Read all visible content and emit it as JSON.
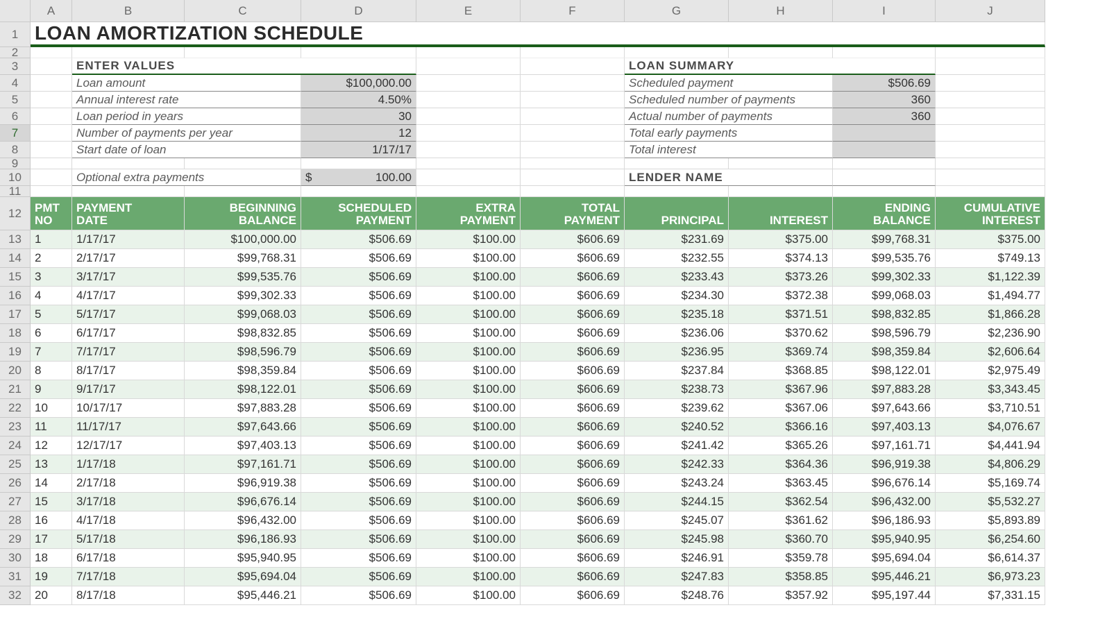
{
  "columns": [
    "A",
    "B",
    "C",
    "D",
    "E",
    "F",
    "G",
    "H",
    "I",
    "J"
  ],
  "rowNumbers": [
    "1",
    "2",
    "3",
    "4",
    "5",
    "6",
    "7",
    "8",
    "9",
    "10",
    "11",
    "12",
    "13",
    "14",
    "15",
    "16",
    "17",
    "18",
    "19",
    "20",
    "21",
    "22",
    "23",
    "24",
    "25",
    "26",
    "27",
    "28",
    "29",
    "30",
    "31",
    "32"
  ],
  "selectedRow": "7",
  "title": "LOAN AMORTIZATION SCHEDULE",
  "enterValues": {
    "heading": "ENTER VALUES",
    "rows": [
      {
        "label": "Loan amount",
        "value": "$100,000.00"
      },
      {
        "label": "Annual interest rate",
        "value": "4.50%"
      },
      {
        "label": "Loan period in years",
        "value": "30"
      },
      {
        "label": "Number of payments per year",
        "value": "12"
      },
      {
        "label": "Start date of loan",
        "value": "1/17/17"
      }
    ],
    "extra": {
      "label": "Optional extra payments",
      "prefix": "$",
      "value": "100.00"
    }
  },
  "loanSummary": {
    "heading": "LOAN SUMMARY",
    "rows": [
      {
        "label": "Scheduled payment",
        "value": "$506.69"
      },
      {
        "label": "Scheduled number of payments",
        "value": "360"
      },
      {
        "label": "Actual number of payments",
        "value": "360"
      },
      {
        "label": "Total early payments",
        "value": ""
      },
      {
        "label": "Total interest",
        "value": ""
      }
    ],
    "lender": {
      "label": "LENDER NAME",
      "value": ""
    }
  },
  "tableHeaders": {
    "pmtNo": [
      "PMT",
      "NO"
    ],
    "paymentDate": [
      "PAYMENT",
      "DATE"
    ],
    "beginningBalance": [
      "BEGINNING",
      "BALANCE"
    ],
    "scheduledPayment": [
      "SCHEDULED",
      "PAYMENT"
    ],
    "extraPayment": [
      "EXTRA",
      "PAYMENT"
    ],
    "totalPayment": [
      "TOTAL",
      "PAYMENT"
    ],
    "principal": [
      "",
      "PRINCIPAL"
    ],
    "interest": [
      "",
      "INTEREST"
    ],
    "endingBalance": [
      "ENDING",
      "BALANCE"
    ],
    "cumulativeInterest": [
      "CUMULATIVE",
      "INTEREST"
    ]
  },
  "schedule": [
    {
      "no": "1",
      "date": "1/17/17",
      "beg": "$100,000.00",
      "sched": "$506.69",
      "extra": "$100.00",
      "total": "$606.69",
      "prin": "$231.69",
      "int": "$375.00",
      "end": "$99,768.31",
      "cum": "$375.00"
    },
    {
      "no": "2",
      "date": "2/17/17",
      "beg": "$99,768.31",
      "sched": "$506.69",
      "extra": "$100.00",
      "total": "$606.69",
      "prin": "$232.55",
      "int": "$374.13",
      "end": "$99,535.76",
      "cum": "$749.13"
    },
    {
      "no": "3",
      "date": "3/17/17",
      "beg": "$99,535.76",
      "sched": "$506.69",
      "extra": "$100.00",
      "total": "$606.69",
      "prin": "$233.43",
      "int": "$373.26",
      "end": "$99,302.33",
      "cum": "$1,122.39"
    },
    {
      "no": "4",
      "date": "4/17/17",
      "beg": "$99,302.33",
      "sched": "$506.69",
      "extra": "$100.00",
      "total": "$606.69",
      "prin": "$234.30",
      "int": "$372.38",
      "end": "$99,068.03",
      "cum": "$1,494.77"
    },
    {
      "no": "5",
      "date": "5/17/17",
      "beg": "$99,068.03",
      "sched": "$506.69",
      "extra": "$100.00",
      "total": "$606.69",
      "prin": "$235.18",
      "int": "$371.51",
      "end": "$98,832.85",
      "cum": "$1,866.28"
    },
    {
      "no": "6",
      "date": "6/17/17",
      "beg": "$98,832.85",
      "sched": "$506.69",
      "extra": "$100.00",
      "total": "$606.69",
      "prin": "$236.06",
      "int": "$370.62",
      "end": "$98,596.79",
      "cum": "$2,236.90"
    },
    {
      "no": "7",
      "date": "7/17/17",
      "beg": "$98,596.79",
      "sched": "$506.69",
      "extra": "$100.00",
      "total": "$606.69",
      "prin": "$236.95",
      "int": "$369.74",
      "end": "$98,359.84",
      "cum": "$2,606.64"
    },
    {
      "no": "8",
      "date": "8/17/17",
      "beg": "$98,359.84",
      "sched": "$506.69",
      "extra": "$100.00",
      "total": "$606.69",
      "prin": "$237.84",
      "int": "$368.85",
      "end": "$98,122.01",
      "cum": "$2,975.49"
    },
    {
      "no": "9",
      "date": "9/17/17",
      "beg": "$98,122.01",
      "sched": "$506.69",
      "extra": "$100.00",
      "total": "$606.69",
      "prin": "$238.73",
      "int": "$367.96",
      "end": "$97,883.28",
      "cum": "$3,343.45"
    },
    {
      "no": "10",
      "date": "10/17/17",
      "beg": "$97,883.28",
      "sched": "$506.69",
      "extra": "$100.00",
      "total": "$606.69",
      "prin": "$239.62",
      "int": "$367.06",
      "end": "$97,643.66",
      "cum": "$3,710.51"
    },
    {
      "no": "11",
      "date": "11/17/17",
      "beg": "$97,643.66",
      "sched": "$506.69",
      "extra": "$100.00",
      "total": "$606.69",
      "prin": "$240.52",
      "int": "$366.16",
      "end": "$97,403.13",
      "cum": "$4,076.67"
    },
    {
      "no": "12",
      "date": "12/17/17",
      "beg": "$97,403.13",
      "sched": "$506.69",
      "extra": "$100.00",
      "total": "$606.69",
      "prin": "$241.42",
      "int": "$365.26",
      "end": "$97,161.71",
      "cum": "$4,441.94"
    },
    {
      "no": "13",
      "date": "1/17/18",
      "beg": "$97,161.71",
      "sched": "$506.69",
      "extra": "$100.00",
      "total": "$606.69",
      "prin": "$242.33",
      "int": "$364.36",
      "end": "$96,919.38",
      "cum": "$4,806.29"
    },
    {
      "no": "14",
      "date": "2/17/18",
      "beg": "$96,919.38",
      "sched": "$506.69",
      "extra": "$100.00",
      "total": "$606.69",
      "prin": "$243.24",
      "int": "$363.45",
      "end": "$96,676.14",
      "cum": "$5,169.74"
    },
    {
      "no": "15",
      "date": "3/17/18",
      "beg": "$96,676.14",
      "sched": "$506.69",
      "extra": "$100.00",
      "total": "$606.69",
      "prin": "$244.15",
      "int": "$362.54",
      "end": "$96,432.00",
      "cum": "$5,532.27"
    },
    {
      "no": "16",
      "date": "4/17/18",
      "beg": "$96,432.00",
      "sched": "$506.69",
      "extra": "$100.00",
      "total": "$606.69",
      "prin": "$245.07",
      "int": "$361.62",
      "end": "$96,186.93",
      "cum": "$5,893.89"
    },
    {
      "no": "17",
      "date": "5/17/18",
      "beg": "$96,186.93",
      "sched": "$506.69",
      "extra": "$100.00",
      "total": "$606.69",
      "prin": "$245.98",
      "int": "$360.70",
      "end": "$95,940.95",
      "cum": "$6,254.60"
    },
    {
      "no": "18",
      "date": "6/17/18",
      "beg": "$95,940.95",
      "sched": "$506.69",
      "extra": "$100.00",
      "total": "$606.69",
      "prin": "$246.91",
      "int": "$359.78",
      "end": "$95,694.04",
      "cum": "$6,614.37"
    },
    {
      "no": "19",
      "date": "7/17/18",
      "beg": "$95,694.04",
      "sched": "$506.69",
      "extra": "$100.00",
      "total": "$606.69",
      "prin": "$247.83",
      "int": "$358.85",
      "end": "$95,446.21",
      "cum": "$6,973.23"
    },
    {
      "no": "20",
      "date": "8/17/18",
      "beg": "$95,446.21",
      "sched": "$506.69",
      "extra": "$100.00",
      "total": "$606.69",
      "prin": "$248.76",
      "int": "$357.92",
      "end": "$95,197.44",
      "cum": "$7,331.15"
    }
  ]
}
